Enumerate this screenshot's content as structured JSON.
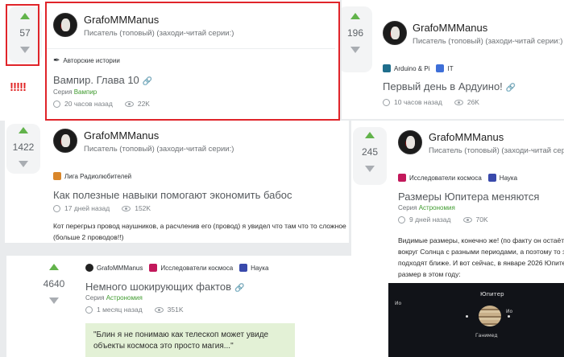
{
  "posts": [
    {
      "votes": "57",
      "author": "GrafoMMManus",
      "status": "Писатель (топовый) (заходи-читай серии:)",
      "communities": [
        {
          "label": "Авторские истории",
          "icon": "feather-icon",
          "color": "#2b2b2b"
        }
      ],
      "title": "Вампир. Глава 10",
      "series_prefix": "Серия",
      "series_name": "Вампир",
      "time": "20 часов назад",
      "views": "22K"
    },
    {
      "votes": "196",
      "author": "GrafoMMManus",
      "status": "Писатель (топовый) (заходи-читай серии:)",
      "communities": [
        {
          "label": "Arduino & Pi",
          "icon": "arduino-icon",
          "color": "#1f6e8c"
        },
        {
          "label": "IT",
          "icon": "it-icon",
          "color": "#3e6fd8"
        }
      ],
      "title": "Первый день в Ардуино!",
      "time": "10 часов назад",
      "views": "26K"
    },
    {
      "votes": "1422",
      "author": "GrafoMMManus",
      "status": "Писатель (топовый) (заходи-читай серии:)",
      "communities": [
        {
          "label": "Лига Радиолюбителей",
          "icon": "radio-icon",
          "color": "#d9862a"
        }
      ],
      "title": "Как полезные навыки помогают экономить бабос",
      "time": "17 дней назад",
      "views": "152K",
      "body": [
        "Кот перегрыз провод наушников, а расчленив его (провод) я увидел что там что то сложное",
        "(больше 2 проводов!!)"
      ]
    },
    {
      "votes": "245",
      "author": "GrafoMMManus",
      "status": "Писатель (топовый) (заходи-читай серии:)",
      "communities": [
        {
          "label": "Исследователи космоса",
          "icon": "space-icon",
          "color": "#c2185b"
        },
        {
          "label": "Наука",
          "icon": "science-icon",
          "color": "#3949ab"
        }
      ],
      "title": "Размеры Юпитера меняются",
      "series_prefix": "Серия",
      "series_name": "Астрономия",
      "time": "9 дней назад",
      "views": "70K",
      "body": [
        "Видимые размеры, конечно же! (по факту он остаётс",
        "вокруг Солнца с разными периодами, а поэтому то з",
        "подходят ближе. И вот сейчас, в январе 2026 Юпитер",
        "размер в этом году:"
      ],
      "image_labels": {
        "a": "Юпитер",
        "b": "Ио",
        "c": "Ио",
        "d": "Ганимед"
      }
    },
    {
      "votes": "4640",
      "communities": [
        {
          "label": "GrafoMMManus",
          "icon": "author-avatar-icon",
          "color": "#222222"
        },
        {
          "label": "Исследователи космоса",
          "icon": "space-icon",
          "color": "#c2185b"
        },
        {
          "label": "Наука",
          "icon": "science-icon",
          "color": "#3949ab"
        }
      ],
      "title": "Немного шокирующих фактов",
      "series_prefix": "Серия",
      "series_name": "Астрономия",
      "time": "1 месяц назад",
      "views": "351K",
      "quote": [
        "\"Блин я не понимаю как телескоп может увиде",
        "объекты космоса это просто магия...\""
      ]
    }
  ],
  "annotation": "!!!!!",
  "colors": {
    "accent": "#3f9b2e",
    "highlight": "#e0242a",
    "upvote": "#62b34b"
  }
}
